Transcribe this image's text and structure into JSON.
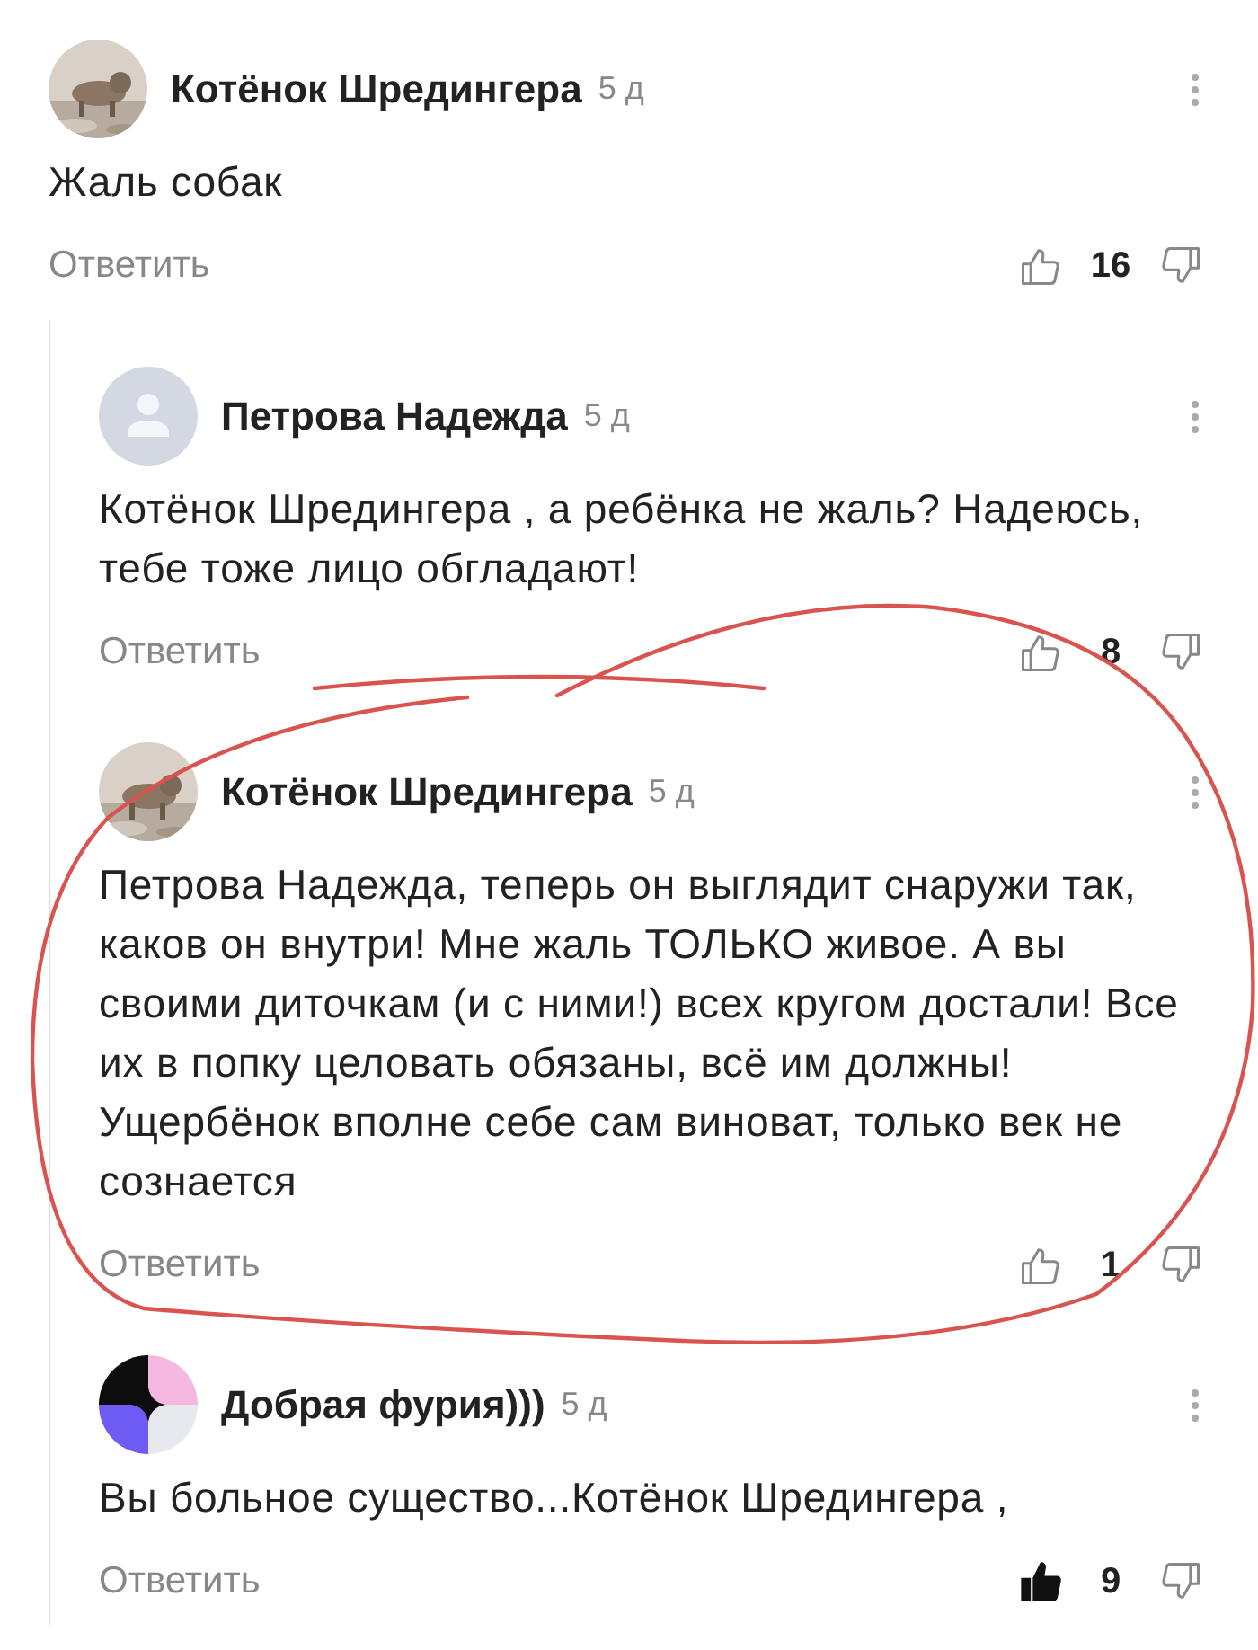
{
  "comments": [
    {
      "author": "Котёнок Шредингера",
      "time": "5 д",
      "text": "Жаль собак",
      "reply_label": "Ответить",
      "likes": "16",
      "liked": false,
      "children": [
        {
          "author": "Петрова Надежда",
          "time": "5 д",
          "avatar": {
            "kind": "default"
          },
          "text": "Котёнок Шредингера , а ребёнка не жаль? Надеюсь, тебе тоже лицо обгладают!",
          "reply_label": "Ответить",
          "likes": "8",
          "liked": false
        },
        {
          "author": "Котёнок Шредингера",
          "time": "5 д",
          "text": "Петрова Надежда, теперь он выглядит снаружи так, каков он внутри! Мне жаль ТОЛЬКО живое. А вы своими диточкам (и с ними!) всех кругом достали! Все их в попку целовать обязаны, всё им должны! Ущербёнок вполне себе сам виноват, только век не сознается",
          "reply_label": "Ответить",
          "likes": "1",
          "liked": false
        },
        {
          "author": "Добрая фурия)))",
          "time": "5 д",
          "avatar": {
            "kind": "pattern"
          },
          "text": "Вы больное существо...Котёнок Шредингера ,",
          "reply_label": "Ответить",
          "likes": "9",
          "liked": true
        }
      ]
    }
  ]
}
